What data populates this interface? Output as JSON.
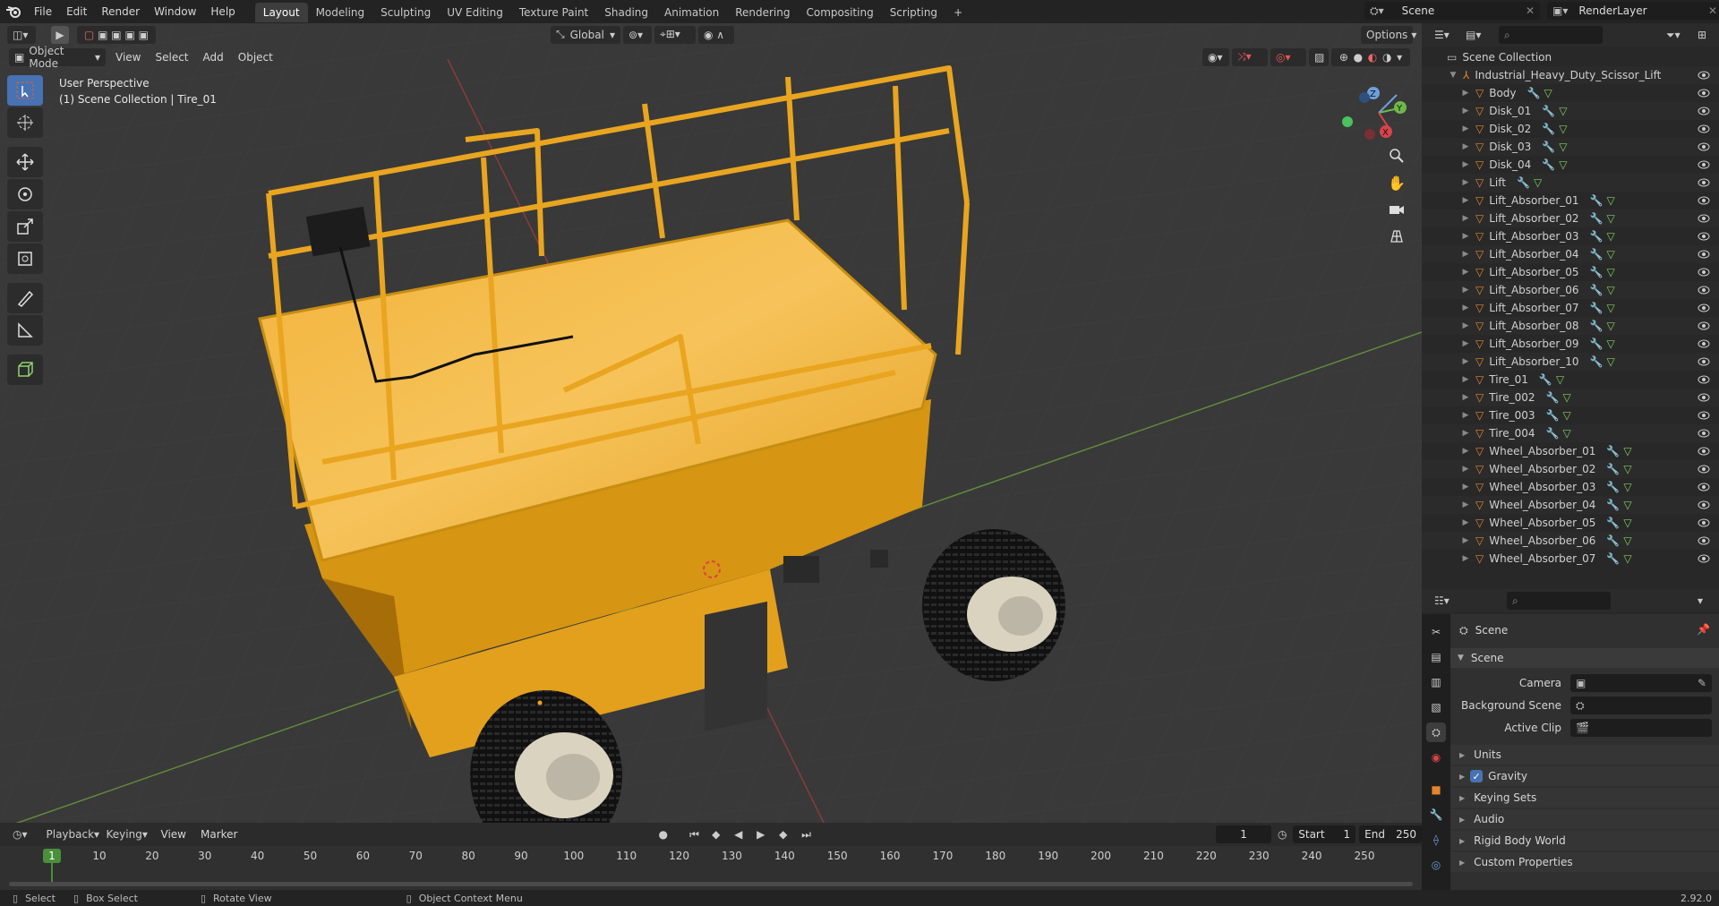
{
  "topbar": {
    "menus": [
      "File",
      "Edit",
      "Render",
      "Window",
      "Help"
    ],
    "workspaces": [
      "Layout",
      "Modeling",
      "Sculpting",
      "UV Editing",
      "Texture Paint",
      "Shading",
      "Animation",
      "Rendering",
      "Compositing",
      "Scripting"
    ],
    "active_workspace": "Layout",
    "add_tab": "+",
    "scene": "Scene",
    "view_layer": "RenderLayer"
  },
  "viewport": {
    "mode": "Object Mode",
    "menus": [
      "View",
      "Select",
      "Add",
      "Object"
    ],
    "orientation": "Global",
    "options": "Options",
    "overlay_title": "User Perspective",
    "overlay_subtitle": "(1) Scene Collection | Tire_01",
    "gizmo": {
      "x": "X",
      "y": "Y",
      "z": "Z"
    }
  },
  "outliner": {
    "collection": "Scene Collection",
    "root": "Industrial_Heavy_Duty_Scissor_Lift",
    "items": [
      "Body",
      "Disk_01",
      "Disk_02",
      "Disk_03",
      "Disk_04",
      "Lift",
      "Lift_Absorber_01",
      "Lift_Absorber_02",
      "Lift_Absorber_03",
      "Lift_Absorber_04",
      "Lift_Absorber_05",
      "Lift_Absorber_06",
      "Lift_Absorber_07",
      "Lift_Absorber_08",
      "Lift_Absorber_09",
      "Lift_Absorber_10",
      "Tire_01",
      "Tire_002",
      "Tire_003",
      "Tire_004",
      "Wheel_Absorber_01",
      "Wheel_Absorber_02",
      "Wheel_Absorber_03",
      "Wheel_Absorber_04",
      "Wheel_Absorber_05",
      "Wheel_Absorber_06",
      "Wheel_Absorber_07"
    ]
  },
  "properties": {
    "context": "Scene",
    "panel": "Scene",
    "camera_label": "Camera",
    "background_label": "Background Scene",
    "clip_label": "Active Clip",
    "subpanels": [
      "Units",
      "Gravity",
      "Keying Sets",
      "Audio",
      "Rigid Body World",
      "Custom Properties"
    ],
    "gravity_checked": true
  },
  "timeline": {
    "menus": [
      "Playback",
      "Keying",
      "View",
      "Marker"
    ],
    "current_frame": "1",
    "start_label": "Start",
    "start": "1",
    "end_label": "End",
    "end": "250",
    "ticks": [
      "10",
      "20",
      "30",
      "40",
      "50",
      "60",
      "70",
      "80",
      "90",
      "100",
      "110",
      "120",
      "130",
      "140",
      "150",
      "160",
      "170",
      "180",
      "190",
      "200",
      "210",
      "220",
      "230",
      "240",
      "250"
    ]
  },
  "statusbar": {
    "select": "Select",
    "box_select": "Box Select",
    "rotate": "Rotate View",
    "context_menu": "Object Context Menu",
    "version": "2.92.0"
  },
  "colors": {
    "accent": "#4772b3",
    "orange": "#e3862b",
    "yellow": "#e8a51c"
  }
}
